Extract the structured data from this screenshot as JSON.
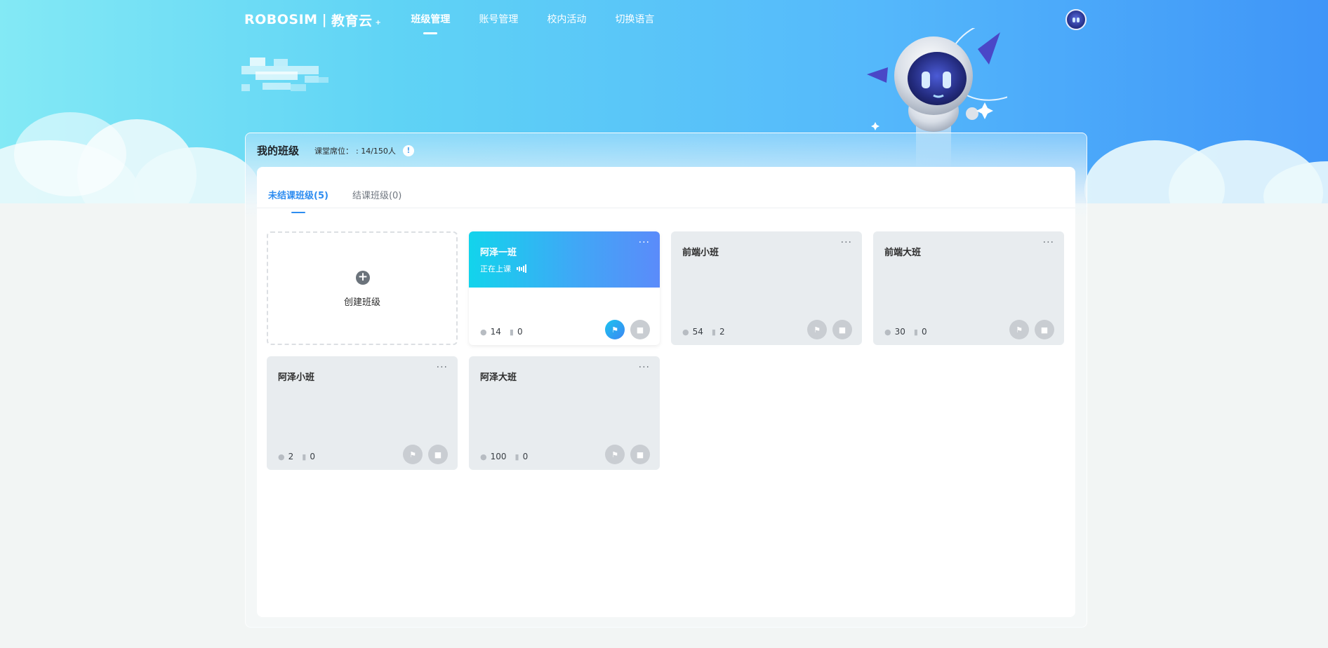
{
  "header": {
    "brand": "ROBOSIM",
    "brand_sep": "|",
    "brand_sub": "教育云",
    "brand_mark": "+",
    "menu": [
      {
        "label": "班级管理",
        "active": true
      },
      {
        "label": "账号管理",
        "active": false
      },
      {
        "label": "校内活动",
        "active": false
      },
      {
        "label": "切换语言",
        "active": false
      }
    ],
    "avatar_icon": "robot-avatar-icon"
  },
  "panel": {
    "title": "我的班级",
    "seat_label": "课堂席位：",
    "seat_value": ": 14/150人",
    "info_icon": "!",
    "tabs": [
      {
        "label": "未结课班级(5)",
        "active": true
      },
      {
        "label": "结课班级(0)",
        "active": false
      }
    ],
    "create_icon": "+",
    "create_label": "创建班级",
    "classes": [
      {
        "name": "阿泽一班",
        "status": "正在上课",
        "students": "14",
        "courses": "0",
        "more": "···",
        "live": true
      },
      {
        "name": "前端小班",
        "status": "",
        "students": "54",
        "courses": "2",
        "more": "···",
        "live": false
      },
      {
        "name": "前端大班",
        "status": "",
        "students": "30",
        "courses": "0",
        "more": "···",
        "live": false
      },
      {
        "name": "阿泽小班",
        "status": "",
        "students": "2",
        "courses": "0",
        "more": "···",
        "live": false
      },
      {
        "name": "阿泽大班",
        "status": "",
        "students": "100",
        "courses": "0",
        "more": "···",
        "live": false
      }
    ]
  },
  "icons": {
    "student": "user-icon",
    "course": "book-icon",
    "flag": "flag-icon",
    "classroom": "classroom-icon"
  },
  "colors": {
    "accent": "#2d8cf0",
    "hero_start": "#83e9f5",
    "hero_end": "#3f95f8",
    "card_live_start": "#12d4ec",
    "card_live_end": "#5b8bfa",
    "card_idle": "#e8ecef"
  }
}
